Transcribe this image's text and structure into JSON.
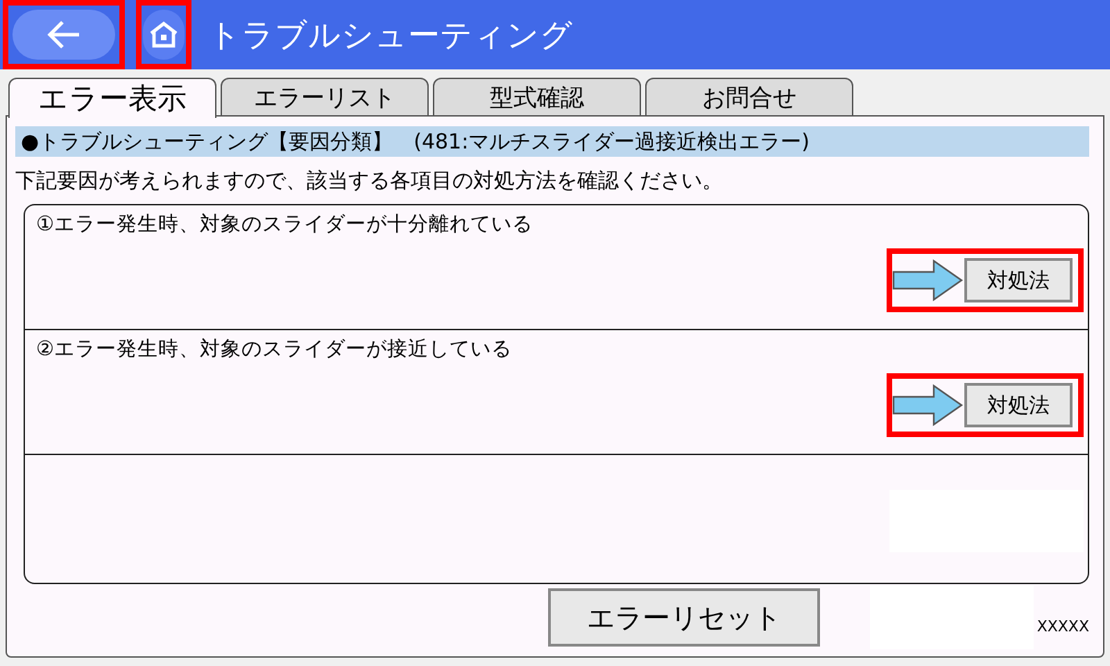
{
  "header": {
    "title": "トラブルシューティング",
    "back_highlighted": true,
    "home_highlighted": true
  },
  "tabs": [
    {
      "label": "エラー表示",
      "selected": true
    },
    {
      "label": "エラーリスト",
      "selected": false
    },
    {
      "label": "型式確認",
      "selected": false
    },
    {
      "label": "お問合せ",
      "selected": false
    }
  ],
  "section_title": "●トラブルシューティング【要因分類】　(481:マルチスライダー過接近検出エラー)",
  "instruction": "下記要因が考えられますので、該当する各項目の対処方法を確認ください。",
  "causes": [
    {
      "text": "①エラー発生時、対象のスライダーが十分離れている",
      "button": "対処法",
      "highlighted": true
    },
    {
      "text": "②エラー発生時、対象のスライダーが接近している",
      "button": "対処法",
      "highlighted": true
    }
  ],
  "reset_button": "エラーリセット",
  "footer_code": "XXXXX"
}
